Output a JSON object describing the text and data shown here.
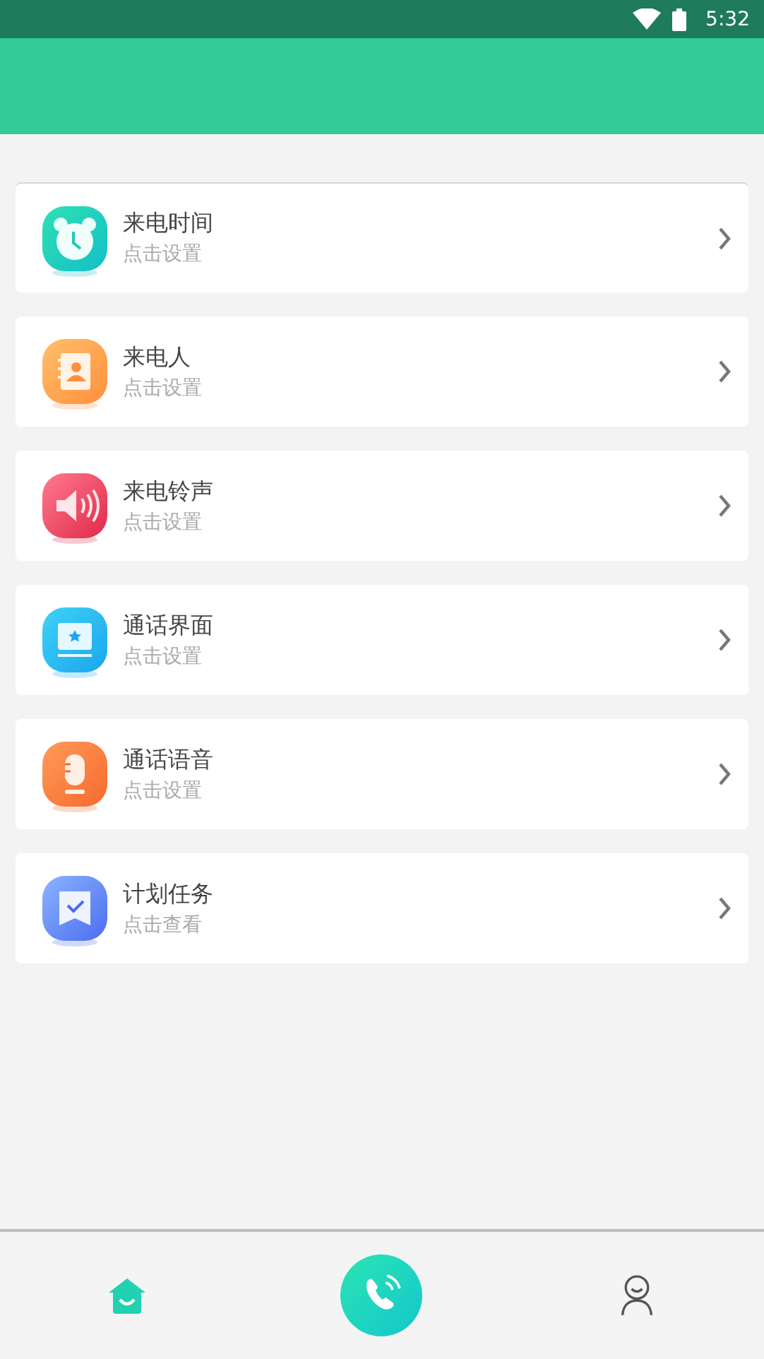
{
  "status_bar": {
    "time": "5:32"
  },
  "items": [
    {
      "title": "来电时间",
      "subtitle": "点击设置"
    },
    {
      "title": "来电人",
      "subtitle": "点击设置"
    },
    {
      "title": "来电铃声",
      "subtitle": "点击设置"
    },
    {
      "title": "通话界面",
      "subtitle": "点击设置"
    },
    {
      "title": "通话语音",
      "subtitle": "点击设置"
    },
    {
      "title": "计划任务",
      "subtitle": "点击查看"
    }
  ],
  "bottom_nav": [
    {
      "kind": "home",
      "selected": true
    },
    {
      "kind": "call",
      "selected": false
    },
    {
      "kind": "profile",
      "selected": false
    }
  ]
}
